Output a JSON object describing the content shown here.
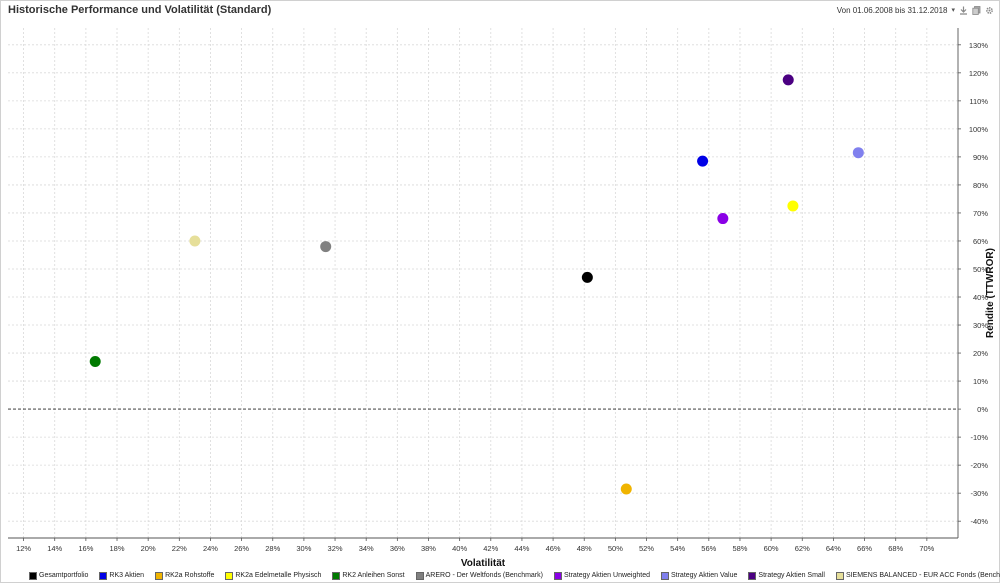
{
  "header": {
    "title": "Historische Performance und Volatilität (Standard)",
    "date_range": "Von 01.06.2008 bis 31.12.2018",
    "icons": [
      "chevron-down-icon",
      "download-icon",
      "copy-icon",
      "gear-icon"
    ]
  },
  "chart_data": {
    "type": "scatter",
    "title": "Historische Performance und Volatilität (Standard)",
    "xlabel": "Volatilität",
    "ylabel": "Rendite (TTWROR)",
    "xlim": [
      11,
      72
    ],
    "ylim": [
      -46,
      136
    ],
    "x_ticks": [
      "12%",
      "14%",
      "16%",
      "18%",
      "20%",
      "22%",
      "24%",
      "26%",
      "28%",
      "30%",
      "32%",
      "34%",
      "36%",
      "38%",
      "40%",
      "42%",
      "44%",
      "46%",
      "48%",
      "50%",
      "52%",
      "54%",
      "56%",
      "58%",
      "60%",
      "62%",
      "64%",
      "66%",
      "68%",
      "70%"
    ],
    "x_tick_values": [
      12,
      14,
      16,
      18,
      20,
      22,
      24,
      26,
      28,
      30,
      32,
      34,
      36,
      38,
      40,
      42,
      44,
      46,
      48,
      50,
      52,
      54,
      56,
      58,
      60,
      62,
      64,
      66,
      68,
      70
    ],
    "y_ticks": [
      "-40%",
      "-30%",
      "-20%",
      "-10%",
      "0%",
      "10%",
      "20%",
      "30%",
      "40%",
      "50%",
      "60%",
      "70%",
      "80%",
      "90%",
      "100%",
      "110%",
      "120%",
      "130%"
    ],
    "y_tick_values": [
      -40,
      -30,
      -20,
      -10,
      0,
      10,
      20,
      30,
      40,
      50,
      60,
      70,
      80,
      90,
      100,
      110,
      120,
      130
    ],
    "grid": true,
    "zero_line": "dashed",
    "legend_position": "bottom",
    "series": [
      {
        "name": "Gesamtportfolio",
        "color": "#000000",
        "x": 48.2,
        "y": 47
      },
      {
        "name": "RK3 Aktien",
        "color": "#0000e6",
        "x": 55.6,
        "y": 88.5
      },
      {
        "name": "RK2a Rohstoffe",
        "color": "#f0b400",
        "x": 50.7,
        "y": -28.5
      },
      {
        "name": "RK2a Edelmetalle Physisch",
        "color": "#ffff00",
        "x": 61.4,
        "y": 72.5
      },
      {
        "name": "RK2 Anleihen Sonst",
        "color": "#007a00",
        "x": 16.6,
        "y": 17
      },
      {
        "name": "ARERO - Der Weltfonds (Benchmark)",
        "color": "#808080",
        "x": 31.4,
        "y": 58
      },
      {
        "name": "Strategy Aktien Unweighted",
        "color": "#8a00e6",
        "x": 56.9,
        "y": 68
      },
      {
        "name": "Strategy Aktien Value",
        "color": "#8080ee",
        "x": 65.6,
        "y": 91.5
      },
      {
        "name": "Strategy Aktien Small",
        "color": "#4b0082",
        "x": 61.1,
        "y": 117.5
      },
      {
        "name": "SIEMENS BALANCED - EUR ACC Fonds (Benchmark)",
        "color": "#e6df9a",
        "x": 23.0,
        "y": 60
      }
    ]
  }
}
